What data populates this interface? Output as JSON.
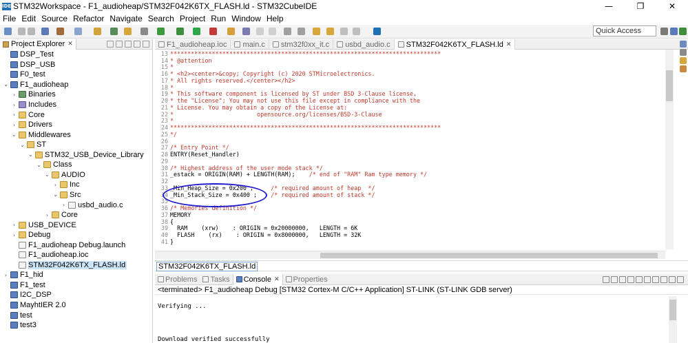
{
  "window": {
    "title": "STM32Workspace - F1_audioheap/STM32F042K6TX_FLASH.ld - STM32CubeIDE",
    "app_icon_text": "IDE",
    "minimize": "—",
    "maximize": "❐",
    "close": "✕"
  },
  "menu": [
    "File",
    "Edit",
    "Source",
    "Refactor",
    "Navigate",
    "Search",
    "Project",
    "Run",
    "Window",
    "Help"
  ],
  "toolbar": {
    "quick_access_placeholder": "Quick Access"
  },
  "project_explorer": {
    "tab_label": "Project Explorer",
    "tree": [
      {
        "label": "DSP_Test",
        "depth": 0,
        "expander": "",
        "icon": "project"
      },
      {
        "label": "DSP_USB",
        "depth": 0,
        "expander": "",
        "icon": "project"
      },
      {
        "label": "F0_test",
        "depth": 0,
        "expander": "",
        "icon": "project"
      },
      {
        "label": "F1_audioheap",
        "depth": 0,
        "expander": "v",
        "icon": "project"
      },
      {
        "label": "Binaries",
        "depth": 1,
        "expander": ">",
        "icon": "binaries"
      },
      {
        "label": "Includes",
        "depth": 1,
        "expander": ">",
        "icon": "package"
      },
      {
        "label": "Core",
        "depth": 1,
        "expander": ">",
        "icon": "folder"
      },
      {
        "label": "Drivers",
        "depth": 1,
        "expander": ">",
        "icon": "folder"
      },
      {
        "label": "Middlewares",
        "depth": 1,
        "expander": "v",
        "icon": "folder"
      },
      {
        "label": "ST",
        "depth": 2,
        "expander": "v",
        "icon": "folder"
      },
      {
        "label": "STM32_USB_Device_Library",
        "depth": 3,
        "expander": "v",
        "icon": "folder"
      },
      {
        "label": "Class",
        "depth": 4,
        "expander": "v",
        "icon": "folder"
      },
      {
        "label": "AUDIO",
        "depth": 5,
        "expander": "v",
        "icon": "folder"
      },
      {
        "label": "Inc",
        "depth": 6,
        "expander": ">",
        "icon": "folder"
      },
      {
        "label": "Src",
        "depth": 6,
        "expander": "v",
        "icon": "folder"
      },
      {
        "label": "usbd_audio.c",
        "depth": 7,
        "expander": ">",
        "icon": "file"
      },
      {
        "label": "Core",
        "depth": 5,
        "expander": ">",
        "icon": "folder"
      },
      {
        "label": "USB_DEVICE",
        "depth": 1,
        "expander": ">",
        "icon": "folder"
      },
      {
        "label": "Debug",
        "depth": 1,
        "expander": ">",
        "icon": "folder"
      },
      {
        "label": "F1_audioheap Debug.launch",
        "depth": 1,
        "expander": "",
        "icon": "file"
      },
      {
        "label": "F1_audioheap.ioc",
        "depth": 1,
        "expander": "",
        "icon": "file"
      },
      {
        "label": "STM32F042K6TX_FLASH.ld",
        "depth": 1,
        "expander": "",
        "icon": "file",
        "selected": true
      },
      {
        "label": "F1_hid",
        "depth": 0,
        "expander": ">",
        "icon": "project"
      },
      {
        "label": "F1_test",
        "depth": 0,
        "expander": "",
        "icon": "project"
      },
      {
        "label": "I2C_DSP",
        "depth": 0,
        "expander": "",
        "icon": "project"
      },
      {
        "label": "MayhtIER 2.0",
        "depth": 0,
        "expander": "",
        "icon": "project"
      },
      {
        "label": "test",
        "depth": 0,
        "expander": "",
        "icon": "project"
      },
      {
        "label": "test3",
        "depth": 0,
        "expander": "",
        "icon": "project"
      }
    ]
  },
  "editor": {
    "tabs": [
      {
        "label": "F1_audioheap.ioc",
        "active": false
      },
      {
        "label": "main.c",
        "active": false
      },
      {
        "label": "stm32f0xx_it.c",
        "active": false
      },
      {
        "label": "usbd_audio.c",
        "active": false
      },
      {
        "label": "STM32F042K6TX_FLASH.ld",
        "active": true
      }
    ],
    "lines": [
      {
        "n": "13",
        "text": "",
        "comment": "******************************************************************************"
      },
      {
        "n": "14",
        "text": "",
        "comment": "* @attention"
      },
      {
        "n": "15",
        "text": "",
        "comment": "*"
      },
      {
        "n": "16",
        "text": "",
        "comment": "* <h2><center>&copy; Copyright (c) 2020 STMicroelectronics."
      },
      {
        "n": "17",
        "text": "",
        "comment": "* All rights reserved.</center></h2>"
      },
      {
        "n": "18",
        "text": "",
        "comment": "*"
      },
      {
        "n": "19",
        "text": "",
        "comment": "* This software component is licensed by ST under BSD 3-Clause license,"
      },
      {
        "n": "20",
        "text": "",
        "comment": "* the \"License\"; You may not use this file except in compliance with the"
      },
      {
        "n": "21",
        "text": "",
        "comment": "* License. You may obtain a copy of the License at:"
      },
      {
        "n": "22",
        "text": "",
        "comment": "*                        opensource.org/licenses/BSD-3-Clause"
      },
      {
        "n": "23",
        "text": "",
        "comment": "*"
      },
      {
        "n": "24",
        "text": "",
        "comment": "******************************************************************************"
      },
      {
        "n": "25",
        "text": "",
        "comment": "*/"
      },
      {
        "n": "26",
        "text": "",
        "comment": ""
      },
      {
        "n": "27",
        "text": "",
        "comment": "/* Entry Point */"
      },
      {
        "n": "28",
        "text": "ENTRY(Reset_Handler)",
        "comment": ""
      },
      {
        "n": "29",
        "text": "",
        "comment": ""
      },
      {
        "n": "30",
        "text": "",
        "comment": "/* Highest address of the user mode stack */"
      },
      {
        "n": "31",
        "text": "_estack = ORIGIN(RAM) + LENGTH(RAM);    ",
        "comment": "/* end of \"RAM\" Ram type memory */"
      },
      {
        "n": "32",
        "text": "",
        "comment": ""
      },
      {
        "n": "33",
        "text": "_Min_Heap_Size = 0x200 ;     ",
        "comment": "/* required amount of heap  */"
      },
      {
        "n": "34",
        "text": "_Min_Stack_Size = 0x400 ;    ",
        "comment": "/* required amount of stack */"
      },
      {
        "n": "35",
        "text": "",
        "comment": ""
      },
      {
        "n": "36",
        "text": "",
        "comment": "/* Memories definition */"
      },
      {
        "n": "37",
        "text": "MEMORY",
        "comment": ""
      },
      {
        "n": "38",
        "text": "{",
        "comment": ""
      },
      {
        "n": "39",
        "text": "  RAM    (xrw)    : ORIGIN = 0x20000000,   LENGTH = 6K",
        "comment": ""
      },
      {
        "n": "40",
        "text": "  FLASH    (rx)    : ORIGIN = 0x8000000,   LENGTH = 32K",
        "comment": ""
      },
      {
        "n": "41",
        "text": "}",
        "comment": ""
      }
    ],
    "breadcrumb": "STM32F042K6TX_FLASH.ld"
  },
  "bottom": {
    "tabs": [
      {
        "label": "Problems",
        "active": false
      },
      {
        "label": "Tasks",
        "active": false
      },
      {
        "label": "Console",
        "active": true
      },
      {
        "label": "Properties",
        "active": false
      }
    ],
    "console_header": "<terminated> F1_audioheap Debug [STM32 Cortex-M C/C++ Application] ST-LINK (ST-LINK GDB server)",
    "console_lines": [
      "Verifying ...",
      "Download verified successfully"
    ]
  },
  "colors": {
    "comment": "#c0392b",
    "selection": "#cce4f7",
    "annotation": "#1d1ad0"
  }
}
